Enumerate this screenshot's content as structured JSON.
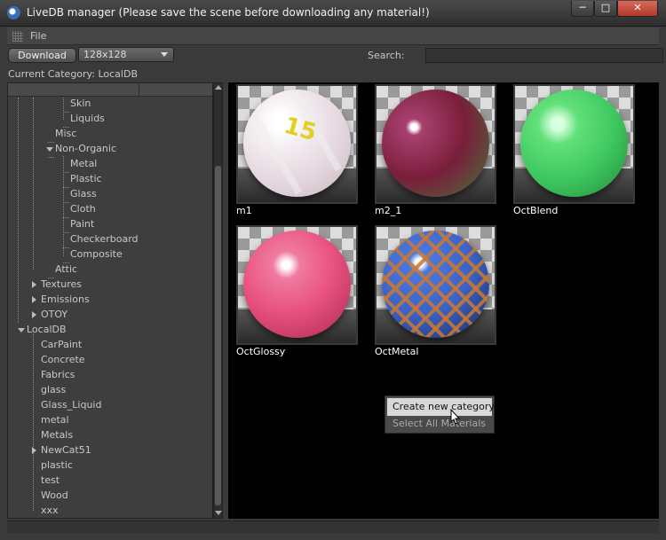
{
  "window": {
    "title": "LiveDB manager   (Please save the scene before downloading any material!)",
    "minimize_icon": "minimize-icon",
    "maximize_icon": "maximize-icon",
    "close_icon": "close-icon"
  },
  "menu": {
    "file_label": "File"
  },
  "toolbar": {
    "download_label": "Download",
    "size_value": "128x128",
    "search_label": "Search:",
    "search_value": "",
    "search_placeholder": ""
  },
  "current_category": "Current Category: LocalDB",
  "tree": {
    "items": [
      {
        "label": "Skin"
      },
      {
        "label": "Liquids"
      },
      {
        "label": "Misc"
      },
      {
        "label": "Non-Organic"
      },
      {
        "label": "Metal"
      },
      {
        "label": "Plastic"
      },
      {
        "label": "Glass"
      },
      {
        "label": "Cloth"
      },
      {
        "label": "Paint"
      },
      {
        "label": "Checkerboard"
      },
      {
        "label": "Composite"
      },
      {
        "label": "Attic"
      },
      {
        "label": "Textures"
      },
      {
        "label": "Emissions"
      },
      {
        "label": "OTOY"
      },
      {
        "label": "LocalDB"
      },
      {
        "label": "CarPaint"
      },
      {
        "label": "Concrete"
      },
      {
        "label": "Fabrics"
      },
      {
        "label": "glass"
      },
      {
        "label": "Glass_Liquid"
      },
      {
        "label": "metal"
      },
      {
        "label": "Metals"
      },
      {
        "label": "NewCat51"
      },
      {
        "label": "plastic"
      },
      {
        "label": "test"
      },
      {
        "label": "Wood"
      },
      {
        "label": "xxx"
      }
    ]
  },
  "materials": [
    {
      "name": "m1",
      "color": "#f0e8ee",
      "ball_number": "15"
    },
    {
      "name": "m2_1",
      "color": "#7a1e3a",
      "ball_number": ""
    },
    {
      "name": "OctBlend",
      "color": "#3fc860",
      "ball_number": ""
    },
    {
      "name": "OctGlossy",
      "color": "#e8507e",
      "ball_number": ""
    },
    {
      "name": "OctMetal",
      "color": "#3a62c8",
      "ball_number": ""
    }
  ],
  "context_menu": {
    "items": [
      {
        "label": "Create new category"
      },
      {
        "label": "Select All Materials"
      }
    ]
  },
  "colors": {
    "background": "#3a3a3a",
    "grid_background": "#000000",
    "close_button": "#c84a3a"
  }
}
